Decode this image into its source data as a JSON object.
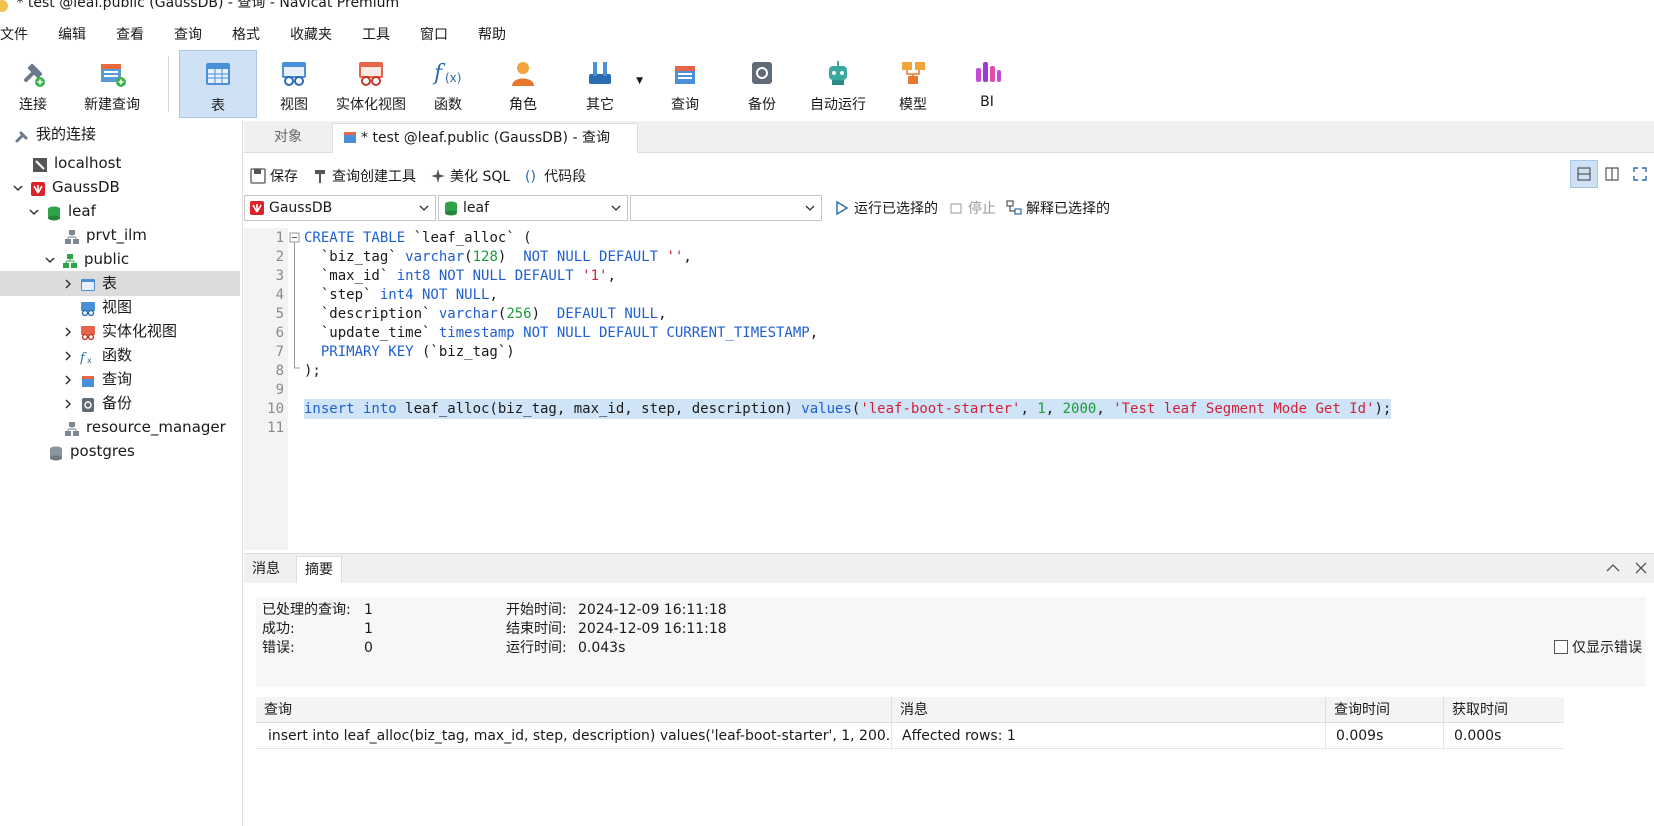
{
  "window": {
    "title": "* test @leaf.public (GaussDB) - 查询 - Navicat Premium"
  },
  "menu": [
    "文件",
    "编辑",
    "查看",
    "查询",
    "格式",
    "收藏夹",
    "工具",
    "窗口",
    "帮助"
  ],
  "toolbar": {
    "connect": "连接",
    "new_query": "新建查询",
    "table": "表",
    "view": "视图",
    "mat_view": "实体化视图",
    "function": "函数",
    "role": "角色",
    "other": "其它",
    "query": "查询",
    "backup": "备份",
    "auto_run": "自动运行",
    "model": "模型",
    "bi": "BI"
  },
  "tree": {
    "root": "我的连接",
    "localhost": "localhost",
    "gaussdb": "GaussDB",
    "leaf": "leaf",
    "prvt_ilm": "prvt_ilm",
    "public": "public",
    "tables": "表",
    "views": "视图",
    "mat_views": "实体化视图",
    "functions": "函数",
    "queries": "查询",
    "backups": "备份",
    "resource_manager": "resource_manager",
    "postgres": "postgres"
  },
  "tabs": {
    "objects": "对象",
    "active": "* test @leaf.public (GaussDB) - 查询"
  },
  "query_toolbar": {
    "save": "保存",
    "builder": "查询创建工具",
    "beautify": "美化 SQL",
    "snippet": "代码段"
  },
  "selectors": {
    "connection": "GaussDB",
    "database": "leaf",
    "schema": "",
    "run_selected": "运行已选择的",
    "stop": "停止",
    "explain_selected": "解释已选择的"
  },
  "editor": {
    "lines": [
      "1",
      "2",
      "3",
      "4",
      "5",
      "6",
      "7",
      "8",
      "9",
      "10",
      "11"
    ]
  },
  "result": {
    "tab_message": "消息",
    "tab_summary": "摘要",
    "processed_label": "已处理的查询:",
    "processed_value": "1",
    "success_label": "成功:",
    "success_value": "1",
    "error_label": "错误:",
    "error_value": "0",
    "start_label": "开始时间:",
    "start_value": "2024-12-09 16:11:18",
    "end_label": "结束时间:",
    "end_value": "2024-12-09 16:11:18",
    "runtime_label": "运行时间:",
    "runtime_value": "0.043s",
    "only_errors": "仅显示错误",
    "columns": [
      "查询",
      "消息",
      "查询时间",
      "获取时间"
    ],
    "row": {
      "query": "insert into leaf_alloc(biz_tag, max_id, step, description) values('leaf-boot-starter', 1, 200...",
      "message": "Affected rows: 1",
      "query_time": "0.009s",
      "fetch_time": "0.000s"
    }
  }
}
